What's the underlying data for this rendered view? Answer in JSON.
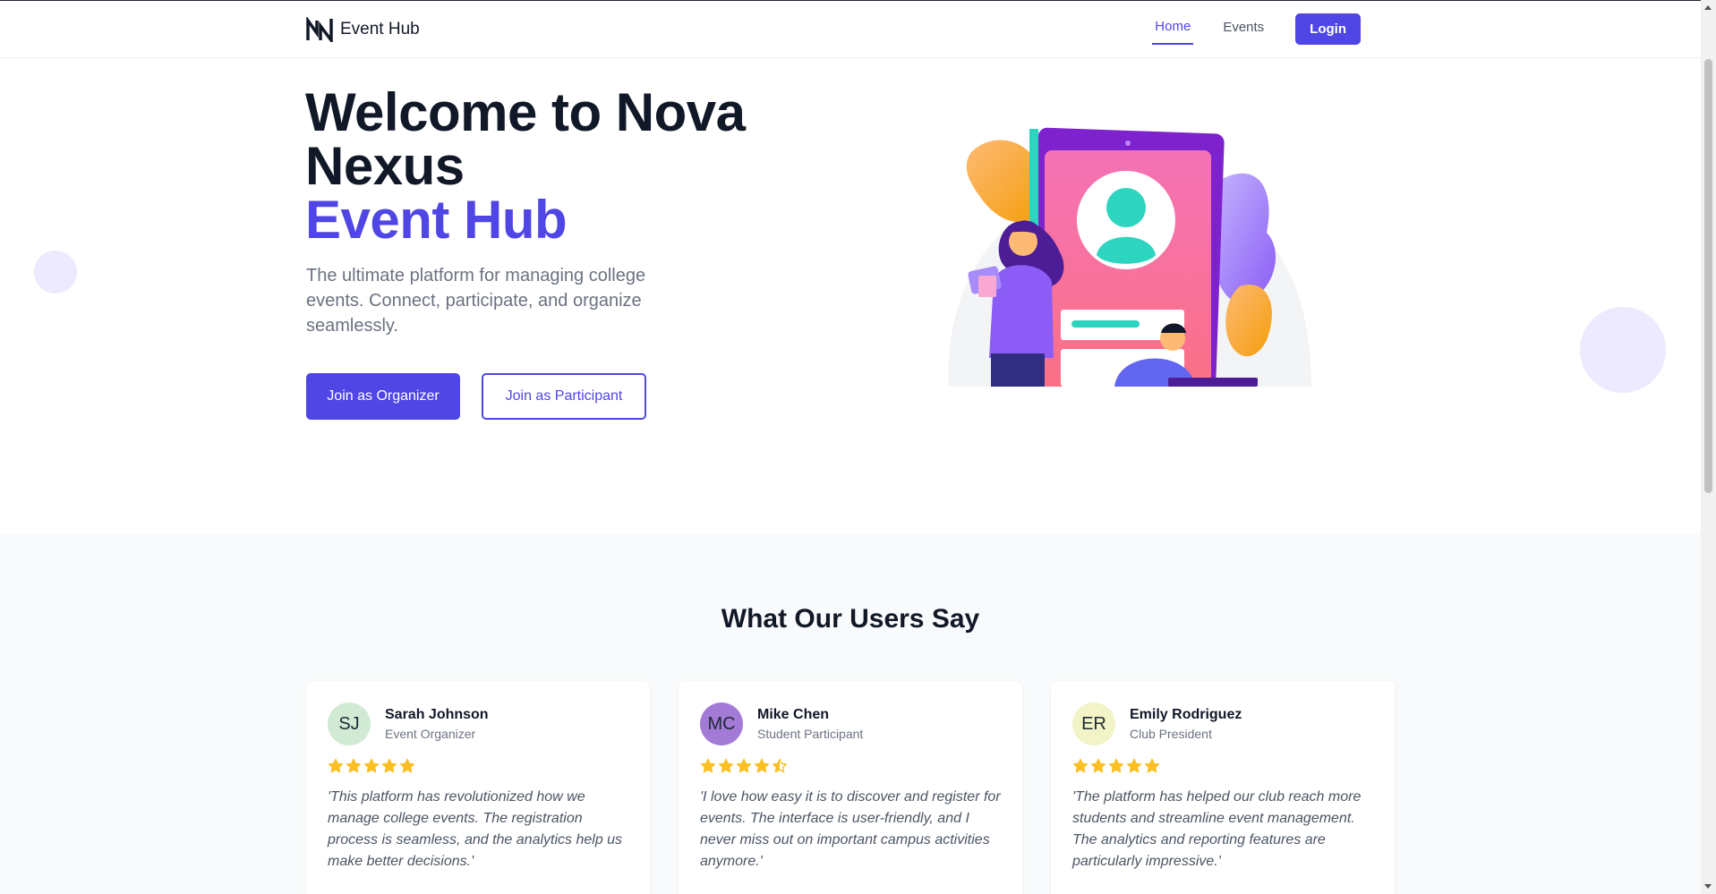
{
  "navbar": {
    "brand": "Event Hub",
    "links": [
      {
        "label": "Home",
        "active": true
      },
      {
        "label": "Events",
        "active": false
      }
    ],
    "login_label": "Login"
  },
  "hero": {
    "title_line1": "Welcome to Nova",
    "title_line2": "Nexus",
    "title_accent": "Event Hub",
    "subtitle": "The ultimate platform for managing college events. Connect, participate, and organize seamlessly.",
    "primary_cta": "Join as Organizer",
    "secondary_cta": "Join as Participant"
  },
  "testimonials": {
    "title": "What Our Users Say",
    "items": [
      {
        "initials": "SJ",
        "name": "Sarah Johnson",
        "role": "Event Organizer",
        "rating": 5,
        "quote": "'This platform has revolutionized how we manage college events. The registration process is seamless, and the analytics help us make better decisions.'",
        "avatar_color": "#d1ead3"
      },
      {
        "initials": "MC",
        "name": "Mike Chen",
        "role": "Student Participant",
        "rating": 4.5,
        "quote": "'I love how easy it is to discover and register for events. The interface is user-friendly, and I never miss out on important campus activities anymore.'",
        "avatar_color": "#a37ad6"
      },
      {
        "initials": "ER",
        "name": "Emily Rodriguez",
        "role": "Club President",
        "rating": 5,
        "quote": "'The platform has helped our club reach more students and streamline event management. The analytics and reporting features are particularly impressive.'",
        "avatar_color": "#f2f4c7"
      }
    ]
  },
  "colors": {
    "accent": "#4f46e5",
    "star": "#fbbf24"
  }
}
